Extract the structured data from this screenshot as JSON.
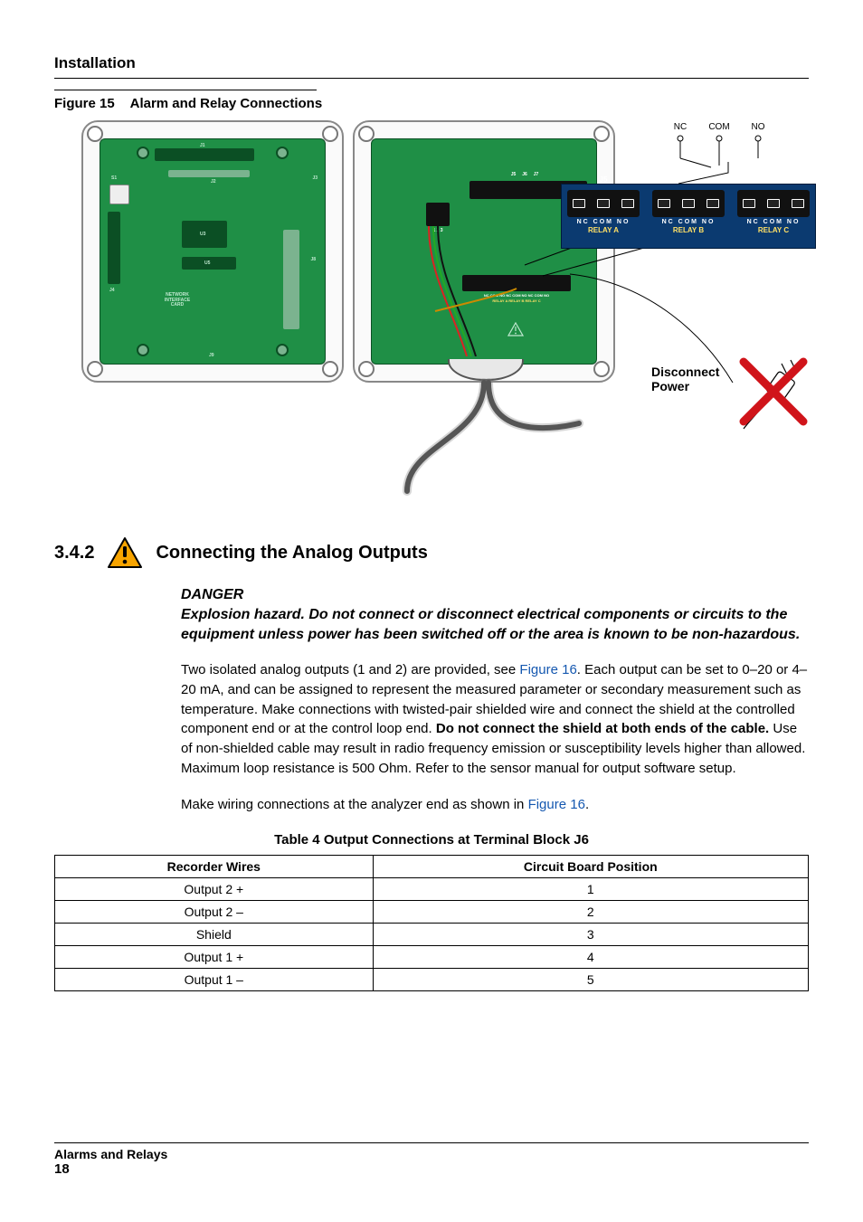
{
  "header": {
    "section": "Installation"
  },
  "figure": {
    "number": "Figure 15",
    "title": "Alarm and Relay Connections",
    "terminal_labels": [
      "NC",
      "COM",
      "NO"
    ],
    "relay_header_pins": "NC   COM   NO",
    "relays": [
      {
        "j": "J5",
        "name": "RELAY A"
      },
      {
        "j": "J6",
        "name": "RELAY B"
      },
      {
        "j": "J7",
        "name": "RELAY C"
      }
    ],
    "disconnect_line1": "Disconnect",
    "disconnect_line2": "Power",
    "pcb_left": {
      "j1": "J1",
      "j2": "J2",
      "j3": "J3",
      "j4": "J4",
      "j8": "J8",
      "j9": "J9",
      "s1": "S1",
      "u3": "U3",
      "u5": "U5",
      "nic_l1": "NETWORK",
      "nic_l2": "INTERFACE",
      "nic_l3": "CARD"
    },
    "pcb_right": {
      "mini_relays_l1": "NC COM NO  NC COM NO  NC COM NO",
      "mini_relays_l2": "RELAY A     RELAY B     RELAY C",
      "conn_num": "1 2 3"
    }
  },
  "subsection": {
    "number": "3.4.2",
    "title": "Connecting the Analog Outputs"
  },
  "danger": {
    "label": "DANGER",
    "text": "Explosion hazard. Do not connect or disconnect electrical components or circuits to the equipment unless power has been switched off or the area is known to be non-hazardous."
  },
  "paragraphs": {
    "p1a": "Two isolated analog outputs (1 and 2) are provided, see ",
    "p1_link": "Figure 16",
    "p1b": ". Each output can be set to 0–20 or 4–20 mA, and can be assigned to represent the measured parameter or secondary measurement such as temperature. Make connections with twisted-pair shielded wire and connect the shield at the controlled component end or at the control loop end. ",
    "p1_bold": "Do not connect the shield at both ends of the cable.",
    "p1c": " Use of non-shielded cable may result in radio frequency emission or susceptibility levels higher than allowed. Maximum loop resistance is 500 Ohm. Refer to the sensor manual for output software setup.",
    "p2a": "Make wiring connections at the analyzer end as shown in ",
    "p2_link": "Figure 16",
    "p2b": "."
  },
  "table": {
    "caption": "Table 4 Output Connections at Terminal Block J6",
    "headers": [
      "Recorder Wires",
      "Circuit Board Position"
    ],
    "rows": [
      [
        "Output 2 +",
        "1"
      ],
      [
        "Output 2 –",
        "2"
      ],
      [
        "Shield",
        "3"
      ],
      [
        "Output 1 +",
        "4"
      ],
      [
        "Output 1 –",
        "5"
      ]
    ]
  },
  "footer": {
    "line1": "Alarms and Relays",
    "page": "18"
  },
  "chart_data": {
    "type": "table",
    "title": "Table 4 Output Connections at Terminal Block J6",
    "columns": [
      "Recorder Wires",
      "Circuit Board Position"
    ],
    "rows": [
      {
        "Recorder Wires": "Output 2 +",
        "Circuit Board Position": 1
      },
      {
        "Recorder Wires": "Output 2 –",
        "Circuit Board Position": 2
      },
      {
        "Recorder Wires": "Shield",
        "Circuit Board Position": 3
      },
      {
        "Recorder Wires": "Output 1 +",
        "Circuit Board Position": 4
      },
      {
        "Recorder Wires": "Output 1 –",
        "Circuit Board Position": 5
      }
    ]
  }
}
